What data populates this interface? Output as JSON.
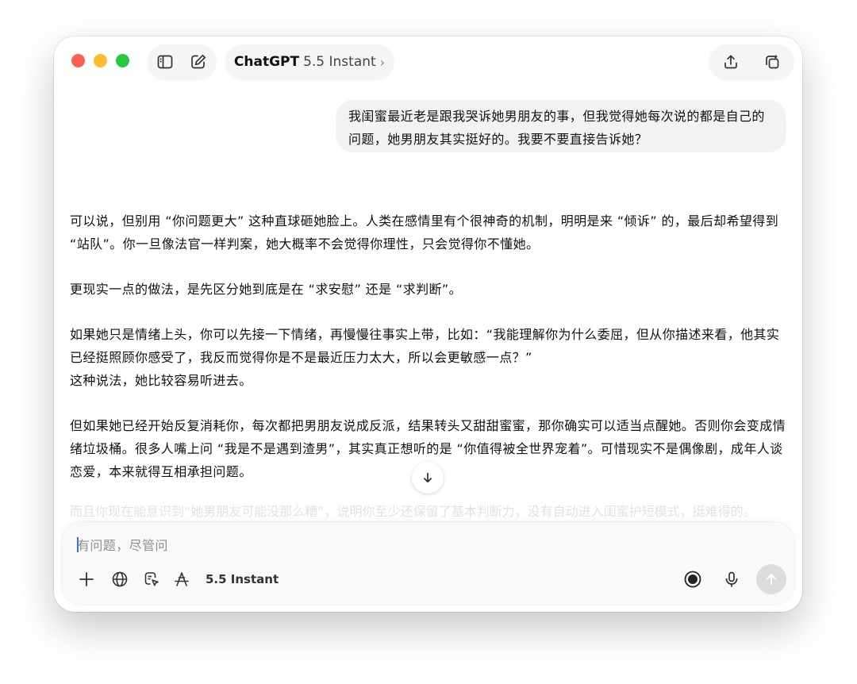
{
  "header": {
    "app_name": "ChatGPT",
    "model": "5.5 Instant"
  },
  "conversation": {
    "user_message": "我闺蜜最近老是跟我哭诉她男朋友的事，但我觉得她每次说的都是自己的问题，她男朋友其实挺好的。我要不要直接告诉她？",
    "assistant_paragraphs": [
      "可以说，但别用 “你问题更大” 这种直球砸她脸上。人类在感情里有个很神奇的机制，明明是来 “倾诉” 的，最后却希望得到 “站队”。你一旦像法官一样判案，她大概率不会觉得你理性，只会觉得你不懂她。",
      "更现实一点的做法，是先区分她到底是在 “求安慰” 还是 “求判断”。",
      "如果她只是情绪上头，你可以先接一下情绪，再慢慢往事实上带，比如：“我能理解你为什么委屈，但从你描述来看，他其实已经挺照顾你感受了，我反而觉得你是不是最近压力太大，所以会更敏感一点？”",
      "这种说法，她比较容易听进去。",
      "但如果她已经开始反复消耗你，每次都把男朋友说成反派，结果转头又甜甜蜜蜜，那你确实可以适当点醒她。否则你会变成情绪垃圾桶。很多人嘴上问 “我是不是遇到渣男”，其实真正想听的是 “你值得被全世界宠着”。可惜现实不是偶像剧，成年人谈恋爱，本来就得互相承担问题。"
    ],
    "faded_line": "而且你现在能意识到“她男朋友可能没那么糟”，说明你至少还保留了基本判断力，没有自动进入闺蜜护短模式，挺难得的。"
  },
  "composer": {
    "placeholder": "有问题，尽管问",
    "model_label": "5.5 Instant"
  },
  "icons": {
    "sidebar": "sidebar-toggle-icon",
    "new_chat": "compose-icon",
    "share": "share-icon",
    "new_window": "new-window-icon",
    "scroll": "arrow-down-icon",
    "plus": "plus-icon",
    "globe": "globe-icon",
    "canvas": "canvas-icon",
    "tools": "tools-icon",
    "voice_mode": "voice-mode-icon",
    "mic": "microphone-icon",
    "send": "send-arrow-icon"
  },
  "colors": {
    "traffic_red": "#fe5f57",
    "traffic_yellow": "#febc2e",
    "traffic_green": "#28c840",
    "user_bubble": "#f2f2f2",
    "send_disabled": "#dcdcdc"
  }
}
